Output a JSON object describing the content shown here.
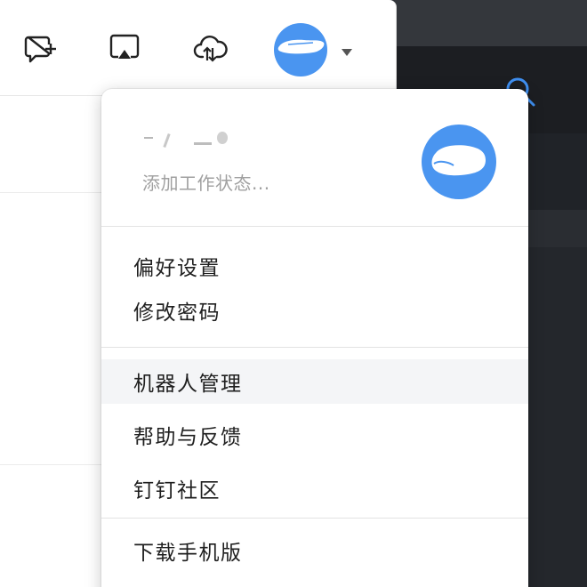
{
  "toolbar": {
    "new_chat_icon": "chat-plus-icon",
    "screen_share_icon": "screen-cast-icon",
    "cloud_icon": "cloud-sync-icon",
    "dropdown_icon": "caret-down-icon"
  },
  "background": {
    "search_icon": "search-icon"
  },
  "popup": {
    "status_placeholder": "添加工作状态...",
    "menu_groups": [
      [
        "偏好设置",
        "修改密码"
      ],
      [
        "机器人管理",
        "帮助与反馈",
        "钉钉社区"
      ],
      [
        "下载手机版"
      ]
    ],
    "hovered_item": "机器人管理"
  },
  "colors": {
    "avatar_blue": "#4a95f0",
    "menu_hover": "#f4f5f7",
    "muted_text": "#a0a0a0"
  }
}
